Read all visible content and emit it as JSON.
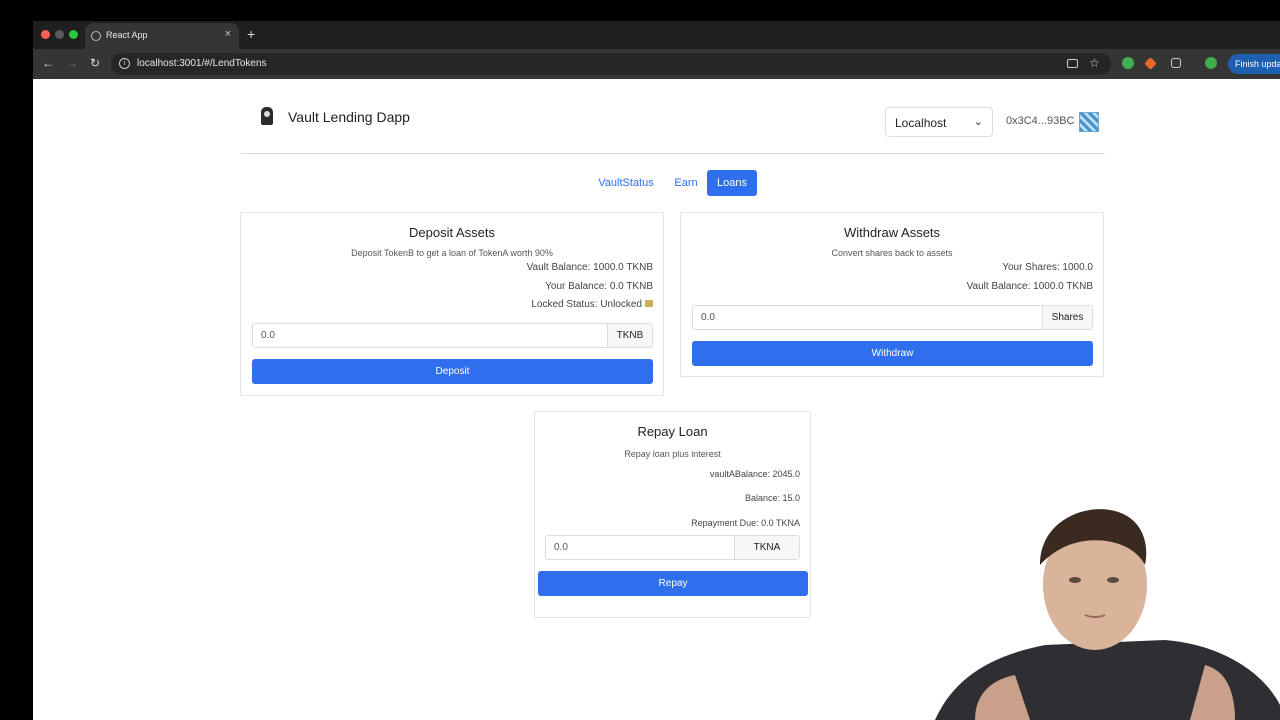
{
  "browser": {
    "tab_title": "React App",
    "url": "localhost:3001/#/LendTokens",
    "update_label": "Finish update"
  },
  "header": {
    "app_title": "Vault Lending Dapp",
    "network": "Localhost",
    "address": "0x3C4...93BC"
  },
  "nav": {
    "tabs": [
      {
        "label": "VaultStatus",
        "active": false
      },
      {
        "label": "Earn",
        "active": false
      },
      {
        "label": "Loans",
        "active": true
      }
    ]
  },
  "deposit": {
    "title": "Deposit Assets",
    "subtitle": "Deposit TokenB to get a loan of TokenA worth 90%",
    "vault_balance": "Vault Balance: 1000.0 TKNB",
    "your_balance": "Your Balance: 0.0 TKNB",
    "locked_status": "Locked Status: Unlocked",
    "input_value": "0.0",
    "unit": "TKNB",
    "button": "Deposit"
  },
  "withdraw": {
    "title": "Withdraw Assets",
    "subtitle": "Convert shares back to assets",
    "your_shares": "Your Shares: 1000.0",
    "vault_balance": "Vault Balance: 1000.0 TKNB",
    "input_value": "0.0",
    "unit": "Shares",
    "button": "Withdraw"
  },
  "repay": {
    "title": "Repay Loan",
    "subtitle": "Repay loan plus interest",
    "vault_a_balance": "vaultABalance: 2045.0",
    "balance": "Balance: 15.0",
    "repayment_due": "Repayment Due: 0.0 TKNA",
    "input_value": "0.0",
    "unit": "TKNA",
    "button": "Repay"
  },
  "colors": {
    "primary": "#2f6fee",
    "link": "#2f6fee"
  }
}
